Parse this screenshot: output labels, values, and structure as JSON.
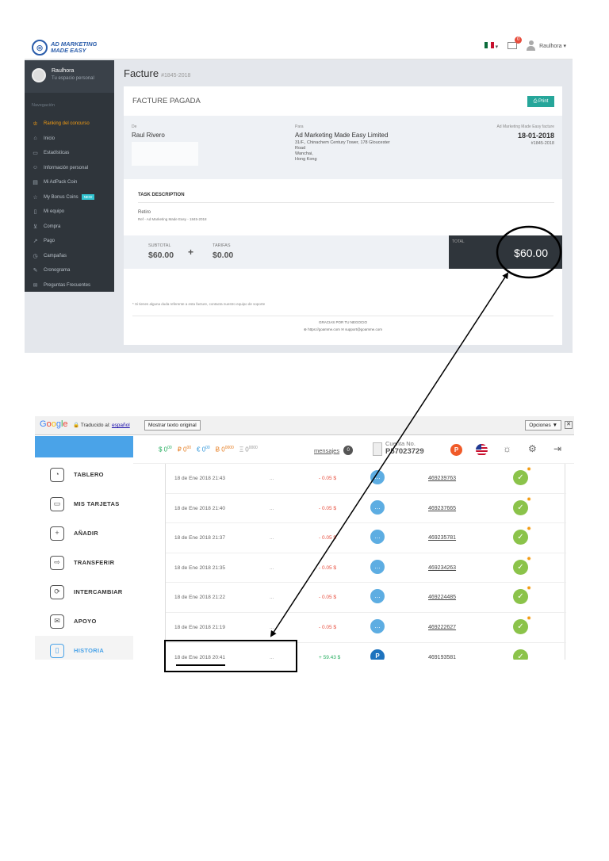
{
  "invoice_screen": {
    "brand": {
      "line1": "AD MARKETING",
      "line2": "MADE EASY"
    },
    "topbar": {
      "mail_count": "0",
      "user_name": "Raulhora ▾",
      "flag_caret": "▾"
    },
    "sidebar": {
      "profile_name": "Raulhora",
      "profile_sub": "Tu espacio personal",
      "heading": "Navegación",
      "items": [
        {
          "label": "Ranking del concurso",
          "icon": "trophy-icon",
          "glyph": "♔",
          "active": true
        },
        {
          "label": "Inicio",
          "icon": "home-icon",
          "glyph": "⌂"
        },
        {
          "label": "Estadísticas",
          "icon": "monitor-icon",
          "glyph": "▭"
        },
        {
          "label": "Información personal",
          "icon": "user-icon",
          "glyph": "☺"
        },
        {
          "label": "Mi AdPack Coin",
          "icon": "calendar-icon",
          "glyph": "▤"
        },
        {
          "label": "My Bonus Coins",
          "icon": "star-icon",
          "glyph": "☆",
          "badge": "NEW"
        },
        {
          "label": "Mi equipo",
          "icon": "doc-icon",
          "glyph": "▯"
        },
        {
          "label": "Compra",
          "icon": "cart-icon",
          "glyph": "⊻"
        },
        {
          "label": "Pago",
          "icon": "export-icon",
          "glyph": "↗"
        },
        {
          "label": "Campañas",
          "icon": "clock-icon",
          "glyph": "◷"
        },
        {
          "label": "Cronograma",
          "icon": "pin-icon",
          "glyph": "✎"
        },
        {
          "label": "Preguntas Frecuentes",
          "icon": "chat-icon",
          "glyph": "✉"
        }
      ]
    },
    "page_title": "Facture",
    "page_subtitle": "#1845-2018",
    "status": "FACTURE PAGADA",
    "print_label": "⎙ Print",
    "from": {
      "label": "De",
      "name": "Raul Rivero"
    },
    "to": {
      "label": "Para",
      "name": "Ad Marketing Made Easy Limited",
      "address": [
        "31/F., Chinachem Century Tower, 178 Gloucester",
        "Road",
        "Wanchai,",
        "Hong Kong"
      ]
    },
    "meta": {
      "label": "Ad Marketing Made Easy facture",
      "date": "18-01-2018",
      "number": "#1845-2018"
    },
    "task_heading": "TASK DESCRIPTION",
    "task_title": "Retiro",
    "task_ref": "Ref - Ad Marketing Made Easy - 1845-2018",
    "subtotal_label": "SUBTOTAL",
    "subtotal": "$60.00",
    "plus": "+",
    "fees_label": "TARIFAS",
    "fees": "$0.00",
    "total_label": "TOTAL",
    "total": "$60.00",
    "note": "* Si tienes alguna duda referente a esta facture, contacta nuestro equipo de soporte",
    "thanks": "GRACIAS POR TU NEGOCIO",
    "contact": "⊕ https://goamme.com   ✉ support@goamme.com"
  },
  "history_screen": {
    "google_bar": {
      "logo_letters": [
        "G",
        "o",
        "o",
        "g",
        "l",
        "e"
      ],
      "translated_prefix": "🔒 Traducido al:",
      "language": "español",
      "show_original": "Mostrar texto original",
      "options": "Opciones ▼",
      "close": "✕"
    },
    "balances": [
      {
        "text": "$ 0",
        "sup": "00",
        "color": "#27ae60"
      },
      {
        "text": "₽ 0",
        "sup": "00",
        "color": "#e67e22"
      },
      {
        "text": "€ 0",
        "sup": "00",
        "color": "#3498db"
      },
      {
        "text": "Ƀ 0",
        "sup": "0000",
        "color": "#e67e22"
      },
      {
        "text": "Ξ 0",
        "sup": "0000",
        "color": "#999999"
      }
    ],
    "messages_label": "mensajes",
    "messages_count": "0",
    "account_label": "Cuenta No.",
    "account_number": "P57023729",
    "p_badge": "P",
    "nav": [
      {
        "label": "TABLERO",
        "icon": "dashboard-icon",
        "glyph": "◔"
      },
      {
        "label": "MIS TARJETAS",
        "icon": "card-icon",
        "glyph": "▭"
      },
      {
        "label": "AÑADIR",
        "icon": "add-icon",
        "glyph": "+"
      },
      {
        "label": "TRANSFERIR",
        "icon": "transfer-icon",
        "glyph": "⇨"
      },
      {
        "label": "INTERCAMBIAR",
        "icon": "exchange-icon",
        "glyph": "⟳"
      },
      {
        "label": "APOYO",
        "icon": "support-icon",
        "glyph": "✉"
      },
      {
        "label": "HISTORIA",
        "icon": "history-icon",
        "glyph": "▯",
        "active": true
      }
    ],
    "rows": [
      {
        "date": "18 de Ene 2018 21:43",
        "mid": "...",
        "amount": "- 0.05 $",
        "sign": "neg",
        "method": "chat",
        "id": "469239763"
      },
      {
        "date": "18 de Ene 2018 21:40",
        "mid": "...",
        "amount": "- 0.05 $",
        "sign": "neg",
        "method": "chat",
        "id": "469237665"
      },
      {
        "date": "18 de Ene 2018 21:37",
        "mid": "...",
        "amount": "- 0.05 $",
        "sign": "neg",
        "method": "chat",
        "id": "469235781"
      },
      {
        "date": "18 de Ene 2018 21:35",
        "mid": "...",
        "amount": "- 0.05 $",
        "sign": "neg",
        "method": "chat",
        "id": "469234263"
      },
      {
        "date": "18 de Ene 2018 21:22",
        "mid": "...",
        "amount": "- 0.05 $",
        "sign": "neg",
        "method": "chat",
        "id": "469224485"
      },
      {
        "date": "18 de Ene 2018 21:19",
        "mid": "...",
        "amount": "- 0.05 $",
        "sign": "neg",
        "method": "chat",
        "id": "469222627"
      },
      {
        "date": "18 de Ene 2018 20:41",
        "mid": "...",
        "amount": "+ 59.43 $",
        "sign": "pos",
        "method": "payeer",
        "id": "469193581"
      }
    ]
  },
  "colors": {
    "annotation": "#000000",
    "sidebar_bg": "#2f353b",
    "accent_blue": "#4aa3e8",
    "print_green": "#26a69a",
    "negative": "#e74c3c",
    "positive": "#27ae60"
  }
}
